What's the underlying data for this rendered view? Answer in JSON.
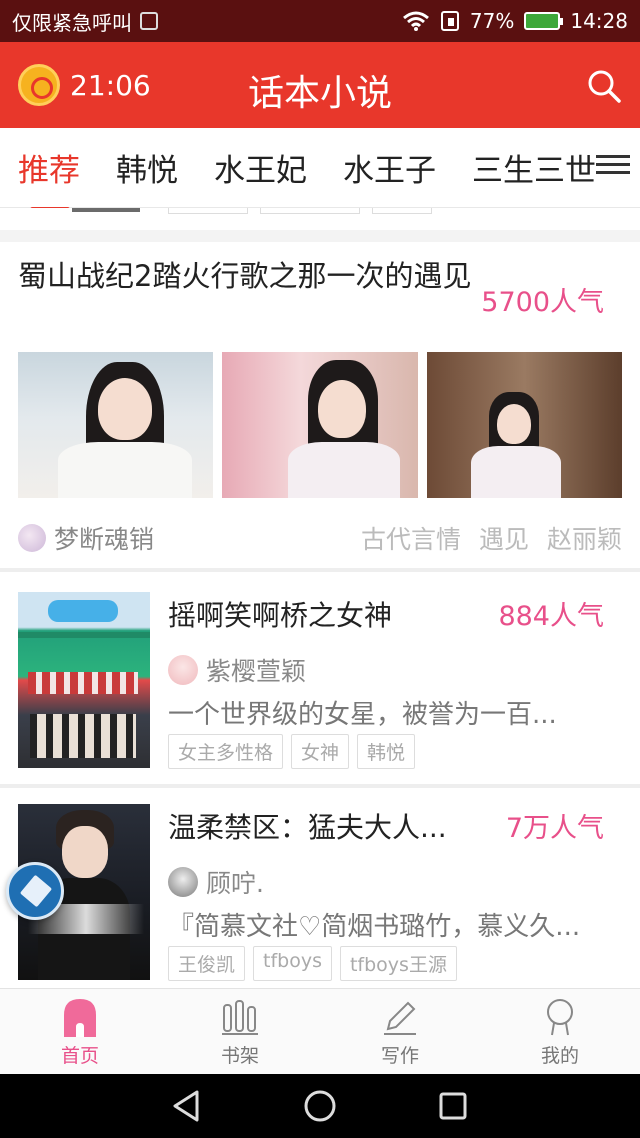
{
  "status_bar": {
    "carrier_text": "仅限紧急呼叫",
    "battery_percent": "77%",
    "time": "14:28"
  },
  "header": {
    "timer": "21:06",
    "title": "话本小说"
  },
  "tabs": [
    "推荐",
    "韩悦",
    "水王妃",
    "水王子",
    "三生三世"
  ],
  "feed": {
    "featured": {
      "title": "蜀山战纪2踏火行歌之那一次的遇见",
      "popularity": "5700人气",
      "author": "梦断魂销",
      "keywords": [
        "古代言情",
        "遇见",
        "赵丽颖"
      ]
    },
    "items": [
      {
        "title": "摇啊笑啊桥之女神",
        "popularity": "884人气",
        "author": "紫樱萱颖",
        "description": "一个世界级的女星，被誉为一百...",
        "tags": [
          "女主多性格",
          "女神",
          "韩悦"
        ]
      },
      {
        "title": "温柔禁区：猛夫大人...",
        "popularity": "7万人气",
        "author": "顾咛.",
        "description": "『简慕文社♡简烟书璐竹，慕义久...",
        "tags": [
          "王俊凯",
          "tfboys",
          "tfboys王源"
        ]
      }
    ]
  },
  "bottom_nav": [
    {
      "label": "首页",
      "active": true
    },
    {
      "label": "书架",
      "active": false
    },
    {
      "label": "写作",
      "active": false
    },
    {
      "label": "我的",
      "active": false
    }
  ],
  "colors": {
    "brand_red": "#e8372b",
    "popularity_pink": "#e8508a"
  }
}
